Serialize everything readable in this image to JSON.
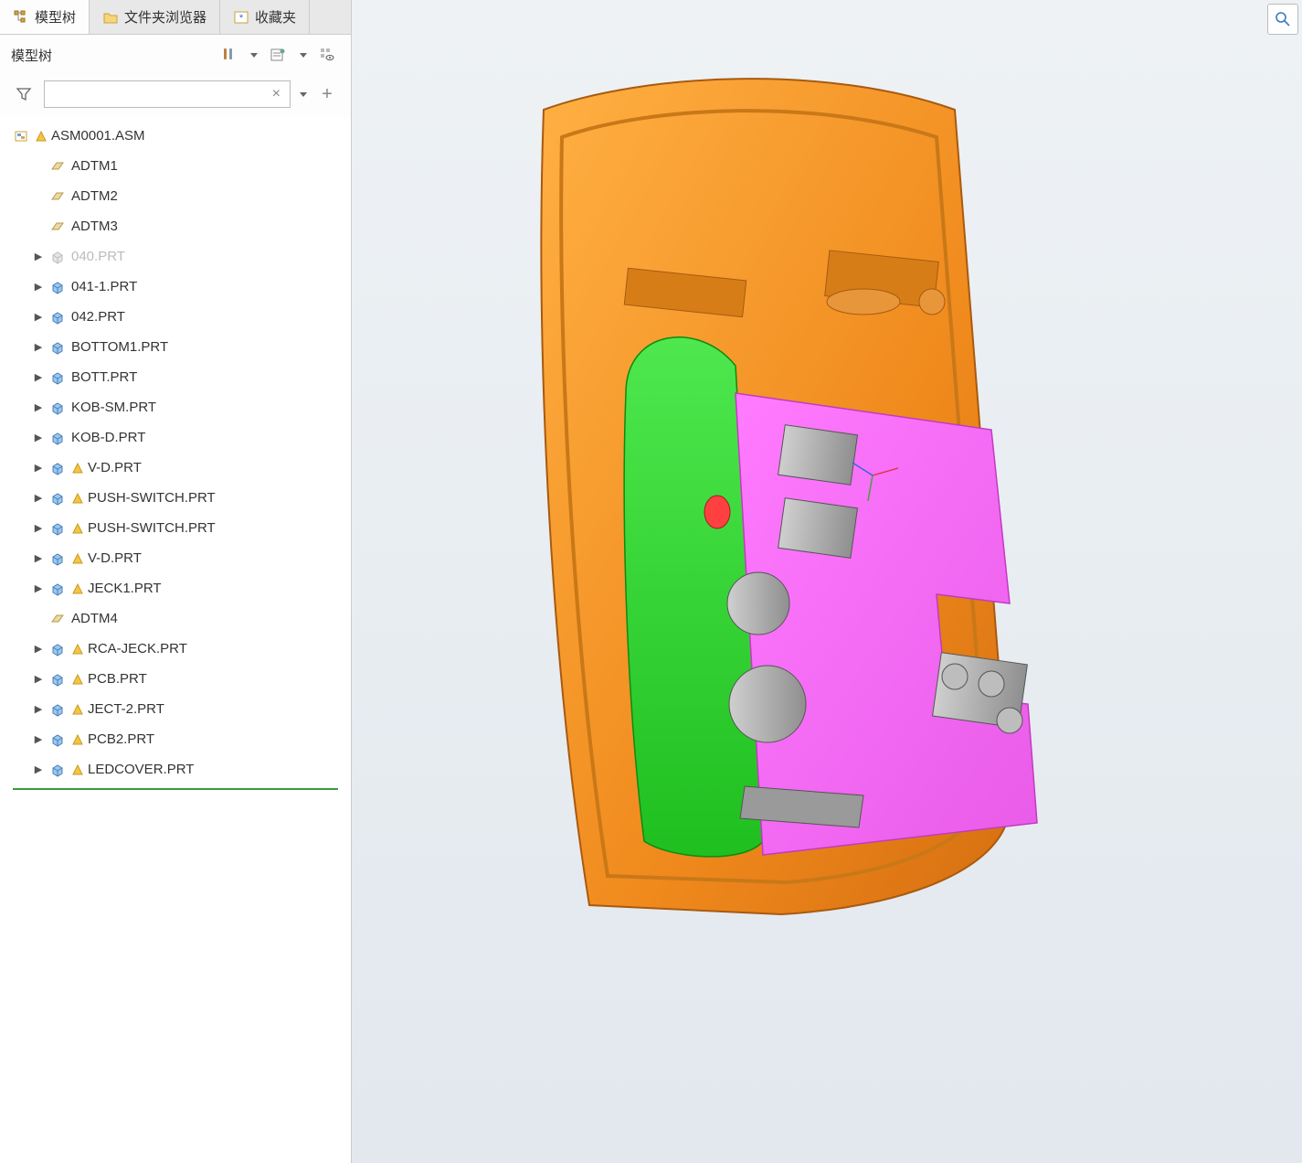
{
  "tabs": {
    "model_tree": "模型树",
    "folder_browser": "文件夹浏览器",
    "favorites": "收藏夹"
  },
  "tree_header": {
    "title": "模型树"
  },
  "filter": {
    "placeholder": ""
  },
  "tree": {
    "root": {
      "label": "ASM0001.ASM",
      "warn": true,
      "icon": "assembly"
    },
    "items": [
      {
        "label": "ADTM1",
        "icon": "datum",
        "expandable": false,
        "warn": false,
        "indent": 1
      },
      {
        "label": "ADTM2",
        "icon": "datum",
        "expandable": false,
        "warn": false,
        "indent": 1
      },
      {
        "label": "ADTM3",
        "icon": "datum",
        "expandable": false,
        "warn": false,
        "indent": 1
      },
      {
        "label": "040.PRT",
        "icon": "part-muted",
        "expandable": true,
        "warn": false,
        "indent": 1,
        "muted": true
      },
      {
        "label": "041-1.PRT",
        "icon": "part",
        "expandable": true,
        "warn": false,
        "indent": 1
      },
      {
        "label": "042.PRT",
        "icon": "part",
        "expandable": true,
        "warn": false,
        "indent": 1
      },
      {
        "label": "BOTTOM1.PRT",
        "icon": "part",
        "expandable": true,
        "warn": false,
        "indent": 1
      },
      {
        "label": "BOTT.PRT",
        "icon": "part",
        "expandable": true,
        "warn": false,
        "indent": 1
      },
      {
        "label": "KOB-SM.PRT",
        "icon": "part",
        "expandable": true,
        "warn": false,
        "indent": 1
      },
      {
        "label": "KOB-D.PRT",
        "icon": "part",
        "expandable": true,
        "warn": false,
        "indent": 1
      },
      {
        "label": "V-D.PRT",
        "icon": "part",
        "expandable": true,
        "warn": true,
        "indent": 1
      },
      {
        "label": "PUSH-SWITCH.PRT",
        "icon": "part",
        "expandable": true,
        "warn": true,
        "indent": 1
      },
      {
        "label": "PUSH-SWITCH.PRT",
        "icon": "part",
        "expandable": true,
        "warn": true,
        "indent": 1
      },
      {
        "label": "V-D.PRT",
        "icon": "part",
        "expandable": true,
        "warn": true,
        "indent": 1
      },
      {
        "label": "JECK1.PRT",
        "icon": "part",
        "expandable": true,
        "warn": true,
        "indent": 1
      },
      {
        "label": "ADTM4",
        "icon": "datum",
        "expandable": false,
        "warn": false,
        "indent": 1
      },
      {
        "label": "RCA-JECK.PRT",
        "icon": "part",
        "expandable": true,
        "warn": true,
        "indent": 1
      },
      {
        "label": "PCB.PRT",
        "icon": "part",
        "expandable": true,
        "warn": true,
        "indent": 1
      },
      {
        "label": "JECT-2.PRT",
        "icon": "part",
        "expandable": true,
        "warn": true,
        "indent": 1
      },
      {
        "label": "PCB2.PRT",
        "icon": "part",
        "expandable": true,
        "warn": true,
        "indent": 1
      },
      {
        "label": "LEDCOVER.PRT",
        "icon": "part",
        "expandable": true,
        "warn": true,
        "indent": 1
      }
    ]
  }
}
